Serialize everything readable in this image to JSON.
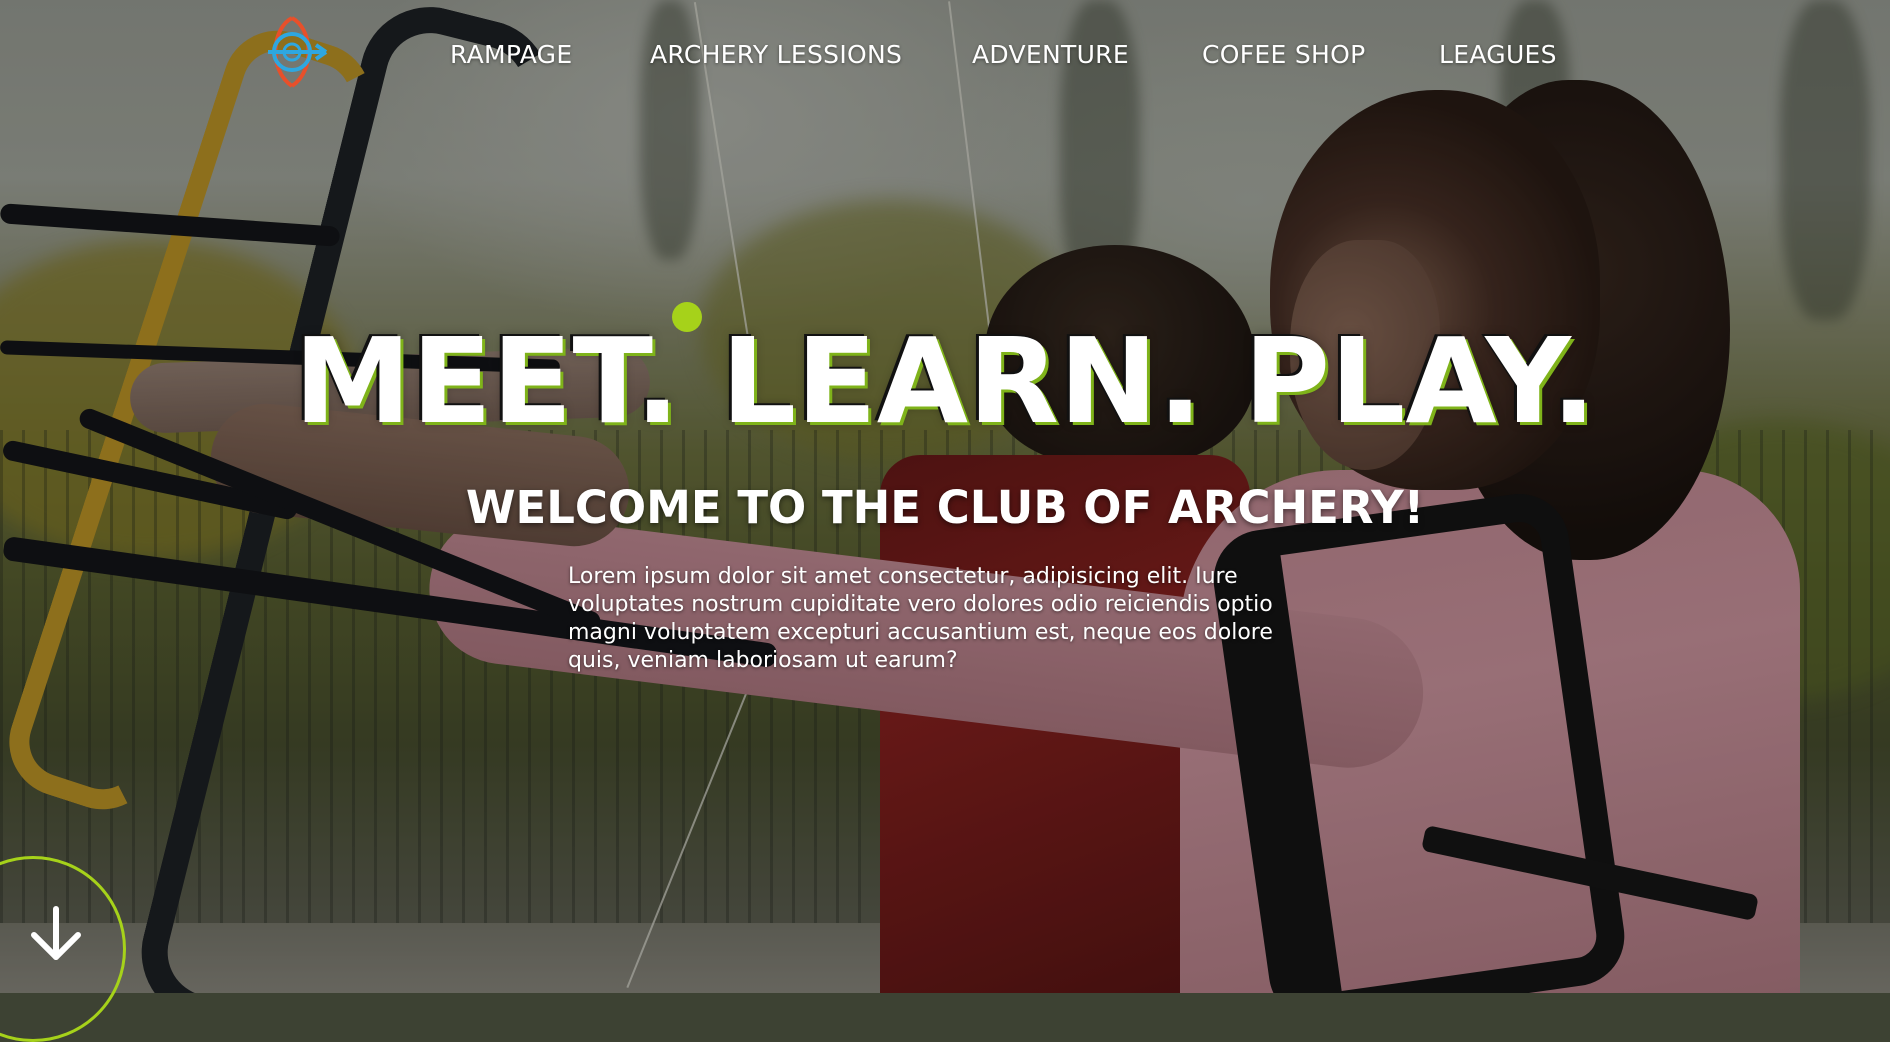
{
  "brand": {
    "logo": "archery-target-arrow-logo",
    "logo_colors": [
      "#2ea7e0",
      "#e8502a"
    ]
  },
  "nav": {
    "items": [
      {
        "label": "RAMPAGE"
      },
      {
        "label": "ARCHERY LESSIONS"
      },
      {
        "label": "ADVENTURE"
      },
      {
        "label": "COFEE SHOP"
      },
      {
        "label": "LEAGUES"
      }
    ]
  },
  "hero": {
    "headline": "MEET. LEARN. PLAY.",
    "subtitle": "WELCOME TO THE CLUB OF ARCHERY!",
    "body": "Lorem ipsum dolor sit amet consectetur, adipisicing elit. Iure voluptates nostrum cupiditate vero dolores odio reiciendis optio magni voluptatem excepturi accusantium est, neque eos dolore quis, veniam laboriosam ut earum?",
    "accent_color": "#a6d21a",
    "background_image": "two archers drawing compound bows outdoors"
  },
  "scroll_button": {
    "icon": "arrow-down-icon",
    "ring_color": "#a6d21a"
  }
}
